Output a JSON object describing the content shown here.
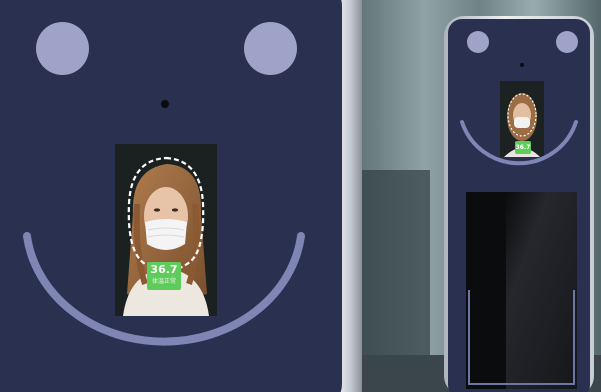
{
  "scene": {
    "description_colors": {
      "device_body": "#2a3050",
      "device_bezel": "#d9dce2",
      "camera_disc": "#9ea3c7",
      "smile_arc": "#7f86b4",
      "temperature_ok": "#5fcb5a"
    }
  },
  "large_terminal": {
    "temperature_value": "36.7",
    "temperature_status": "体温正常"
  },
  "small_terminal": {
    "temperature_value": "36.7"
  }
}
